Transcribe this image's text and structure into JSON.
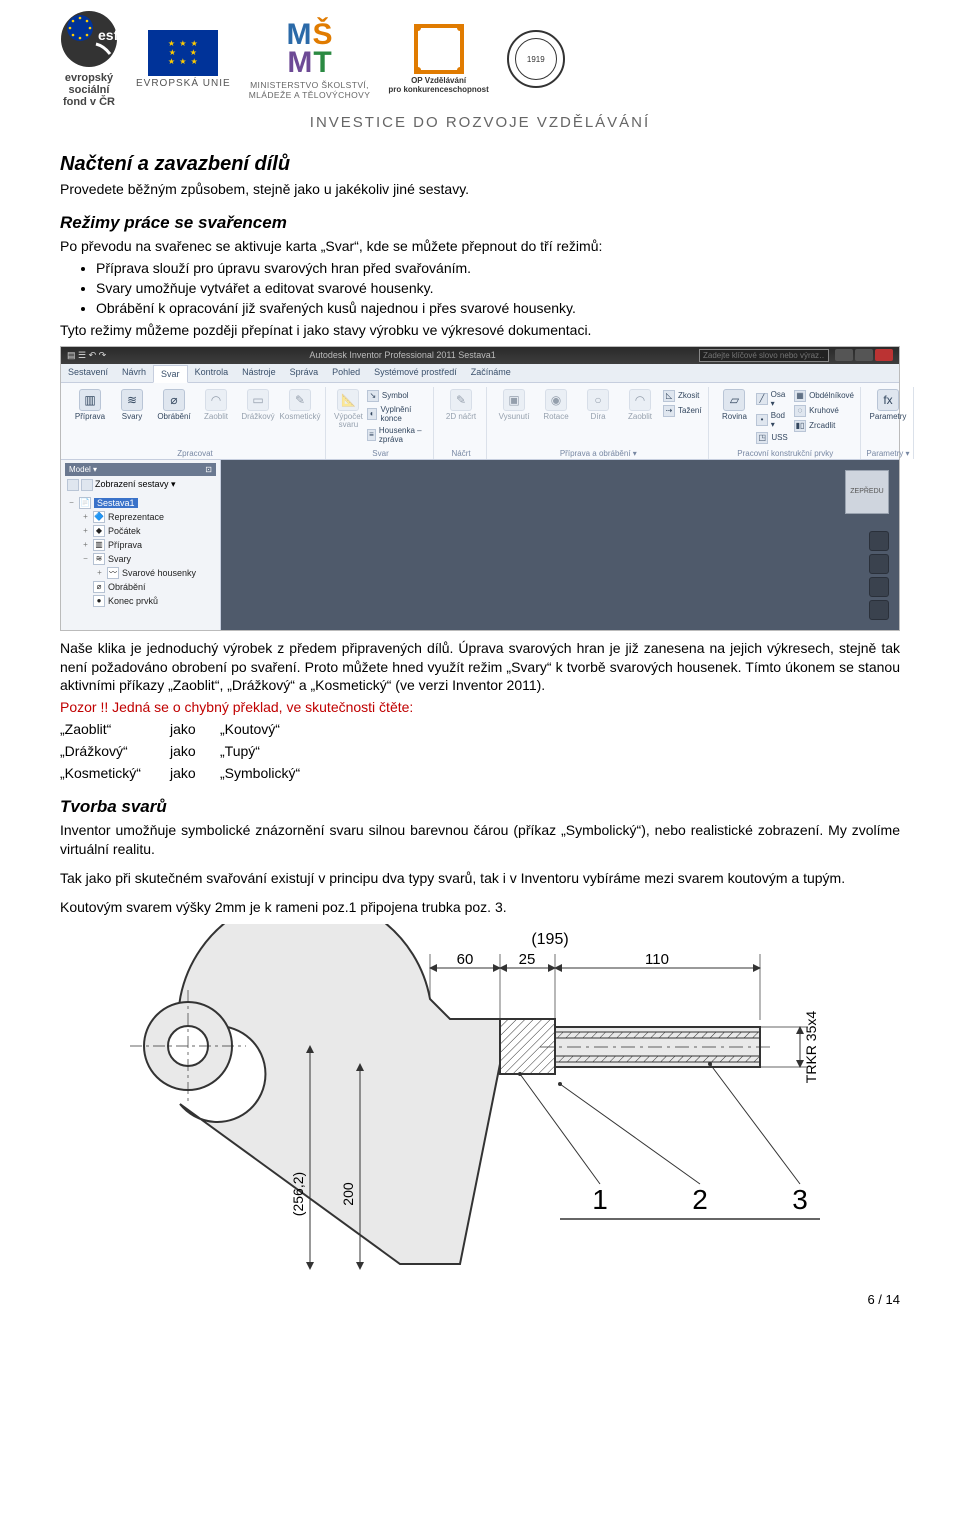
{
  "header": {
    "esf": {
      "abbr": "esf",
      "line1": "evropský",
      "line2": "sociální",
      "line3": "fond v ČR"
    },
    "eu_label": "EVROPSKÁ UNIE",
    "msmt": {
      "letters": "MŠMT",
      "caption1": "MINISTERSTVO ŠKOLSTVÍ,",
      "caption2": "MLÁDEŽE A TĚLOVÝCHOVY"
    },
    "op": {
      "line1": "OP Vzdělávání",
      "line2": "pro konkurenceschopnost"
    },
    "seal_year": "1919",
    "investice": "INVESTICE DO ROZVOJE VZDĚLÁVÁNÍ"
  },
  "s1": {
    "heading": "Načtení a zavazbení dílů",
    "p1": "Provedete běžným způsobem, stejně jako u jakékoliv jiné sestavy."
  },
  "s2": {
    "heading": "Režimy práce se svařencem",
    "p1": "Po převodu na svařenec se aktivuje karta „Svar“, kde se můžete přepnout do tří režimů:",
    "li1": "Příprava slouží pro úpravu svarových hran před svařováním.",
    "li2": "Svary umožňuje vytvářet a editovat svarové housenky.",
    "li3": "Obrábění k opracování již svařených kusů najednou i přes svarové housenky.",
    "p2": "Tyto režimy můžeme později přepínat i jako stavy výrobku ve výkresové dokumentaci."
  },
  "screenshot": {
    "title_center": "Autodesk Inventor Professional 2011   Sestava1",
    "search_placeholder": "Zadejte klíčové slovo nebo výraz…",
    "tabs": [
      "Sestavení",
      "Návrh",
      "Svar",
      "Kontrola",
      "Nástroje",
      "Správa",
      "Pohled",
      "Systémové prostředí",
      "Začínáme"
    ],
    "active_tab_index": 2,
    "ribbon": {
      "groups": [
        {
          "label": "Zpracovat",
          "buttons": [
            {
              "name": "priprava",
              "label": "Příprava",
              "icon": "▥"
            },
            {
              "name": "svary",
              "label": "Svary",
              "icon": "≋"
            },
            {
              "name": "obrabeni",
              "label": "Obrábění",
              "icon": "⌀"
            },
            {
              "name": "zaoblit",
              "label": "Zaoblit",
              "icon": "◠",
              "dim": true
            },
            {
              "name": "drazkovy",
              "label": "Drážkový",
              "icon": "▭",
              "dim": true
            },
            {
              "name": "kosmeticky",
              "label": "Kosmetický",
              "icon": "✎",
              "dim": true
            }
          ]
        },
        {
          "label": "Svar",
          "stacks": [
            [
              {
                "name": "symbol",
                "label": "Symbol",
                "icon": "↘"
              },
              {
                "name": "vyplneni-konce",
                "label": "Vyplnění konce",
                "icon": "◐"
              },
              {
                "name": "housenka-zprava",
                "label": "Housenka – zpráva",
                "icon": "≡"
              }
            ]
          ],
          "buttons": [
            {
              "name": "vypocet-svaru",
              "label": "Výpočet svaru",
              "icon": "📐",
              "dim": true
            }
          ]
        },
        {
          "label": "Náčrt",
          "buttons": [
            {
              "name": "2d-nacrt",
              "label": "2D náčrt",
              "icon": "✎",
              "dim": true
            }
          ]
        },
        {
          "label": "Příprava a obrábění ▾",
          "stacks": [
            [
              {
                "name": "zkosit",
                "label": "Zkosit",
                "icon": "◺"
              },
              {
                "name": "tazeni",
                "label": "Tažení",
                "icon": "⇢"
              }
            ]
          ],
          "buttons": [
            {
              "name": "vysunuti",
              "label": "Vysunutí",
              "icon": "▣",
              "dim": true
            },
            {
              "name": "rotace",
              "label": "Rotace",
              "icon": "◉",
              "dim": true
            },
            {
              "name": "dira",
              "label": "Díra",
              "icon": "○",
              "dim": true
            },
            {
              "name": "zaoblit2",
              "label": "Zaoblit",
              "icon": "◠",
              "dim": true
            }
          ]
        },
        {
          "label": "Pracovní konstrukční prvky",
          "buttons": [
            {
              "name": "rovina",
              "label": "Rovina",
              "icon": "▱"
            }
          ],
          "stacks": [
            [
              {
                "name": "osa",
                "label": "Osa ▾",
                "icon": "╱"
              },
              {
                "name": "bod",
                "label": "Bod ▾",
                "icon": "•"
              },
              {
                "name": "uss",
                "label": "USS",
                "icon": "◳"
              }
            ],
            [
              {
                "name": "obdelnikove",
                "label": "Obdélníkové",
                "icon": "▦"
              },
              {
                "name": "kruhove",
                "label": "Kruhové",
                "icon": "◌"
              },
              {
                "name": "zrcadlit",
                "label": "Zrcadlit",
                "icon": "▮▯"
              }
            ]
          ]
        },
        {
          "label": "Parametry ▾",
          "buttons": [
            {
              "name": "parametry",
              "label": "Parametry",
              "icon": "fx"
            }
          ]
        }
      ]
    },
    "model_panel": {
      "header": "Model ▾",
      "toolbar_label": "Zobrazení sestavy ▾",
      "tree": [
        {
          "name": "sestava1",
          "label": "Sestava1",
          "icon": "📄",
          "selected": true,
          "exp": "−",
          "indent": 0
        },
        {
          "name": "reprezentace",
          "label": "Reprezentace",
          "icon": "🔷",
          "exp": "+",
          "indent": 1
        },
        {
          "name": "pocatek",
          "label": "Počátek",
          "icon": "◆",
          "exp": "+",
          "indent": 1
        },
        {
          "name": "priprava",
          "label": "Příprava",
          "icon": "▥",
          "exp": "+",
          "indent": 1
        },
        {
          "name": "svary-node",
          "label": "Svary",
          "icon": "≋",
          "exp": "−",
          "indent": 1
        },
        {
          "name": "svarove-housenky",
          "label": "Svarové housenky",
          "icon": "〰",
          "exp": "+",
          "indent": 2
        },
        {
          "name": "obrabeni-node",
          "label": "Obrábění",
          "icon": "⌀",
          "indent": 1
        },
        {
          "name": "konec-prvku",
          "label": "Konec prvků",
          "icon": "●",
          "indent": 1
        }
      ]
    },
    "viewcube": "ZEPŘEDU"
  },
  "s3": {
    "p1": "Naše klika je jednoduchý výrobek z předem připravených dílů. Úprava svarových hran je již zanesena na jejich výkresech, stejně tak není požadováno obrobení po svaření. Proto můžete hned využít režim „Svary“ k tvorbě svarových housenek. Tímto úkonem se stanou aktivními příkazy „Zaoblit“, „Drážkový“ a „Kosmetický“ (ve verzi Inventor 2011).",
    "warn": "Pozor !! Jedná se o chybný překlad, ve skutečnosti čtěte:",
    "row1": {
      "a": "„Zaoblit“",
      "b": "jako",
      "c": "„Koutový“"
    },
    "row2": {
      "a": "„Drážkový“",
      "b": "jako",
      "c": "„Tupý“"
    },
    "row3": {
      "a": "„Kosmetický“",
      "b": "jako",
      "c": "„Symbolický“"
    }
  },
  "s4": {
    "heading": "Tvorba svarů",
    "p1": "Inventor umožňuje symbolické znázornění svaru silnou barevnou čárou (příkaz „Symbolický“), nebo realistické zobrazení. My zvolíme virtuální realitu.",
    "p2": "Tak jako při skutečném svařování existují v principu dva typy svarů, tak i v Inventoru vybíráme mezi svarem koutovým a tupým.",
    "p3": "Koutovým svarem výšky 2mm je k rameni poz.1 připojena trubka poz. 3."
  },
  "drawing": {
    "dim_195": "(195)",
    "dim_60": "60",
    "dim_25": "25",
    "dim_110": "110",
    "dim_256": "(256,2)",
    "dim_200": "200",
    "dim_trkr": "TRKR 35x4",
    "pos1": "1",
    "pos2": "2",
    "pos3": "3"
  },
  "pagenum": "6 / 14"
}
